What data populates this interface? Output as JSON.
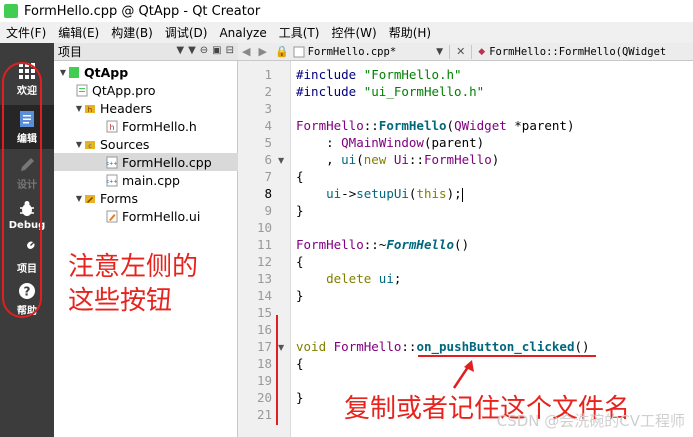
{
  "window": {
    "title": "FormHello.cpp @ QtApp - Qt Creator"
  },
  "menu": [
    "文件(F)",
    "编辑(E)",
    "构建(B)",
    "调试(D)",
    "Analyze",
    "工具(T)",
    "控件(W)",
    "帮助(H)"
  ],
  "modes": [
    {
      "label": "欢迎",
      "icon": "grid-icon"
    },
    {
      "label": "编辑",
      "icon": "document-edit-icon"
    },
    {
      "label": "设计",
      "icon": "pencil-icon"
    },
    {
      "label": "Debug",
      "icon": "bug-icon"
    },
    {
      "label": "项目",
      "icon": "wrench-icon"
    },
    {
      "label": "帮助",
      "icon": "help-icon"
    }
  ],
  "project_panel": {
    "title": "项目",
    "tree": [
      {
        "label": "QtApp",
        "level": 0,
        "kind": "project",
        "expanded": true
      },
      {
        "label": "QtApp.pro",
        "level": 1,
        "kind": "pro"
      },
      {
        "label": "Headers",
        "level": 1,
        "kind": "folder",
        "expanded": true
      },
      {
        "label": "FormHello.h",
        "level": 2,
        "kind": "header"
      },
      {
        "label": "Sources",
        "level": 1,
        "kind": "folder",
        "expanded": true
      },
      {
        "label": "FormHello.cpp",
        "level": 2,
        "kind": "cpp",
        "selected": true
      },
      {
        "label": "main.cpp",
        "level": 2,
        "kind": "cpp"
      },
      {
        "label": "Forms",
        "level": 1,
        "kind": "folder",
        "expanded": true
      },
      {
        "label": "FormHello.ui",
        "level": 2,
        "kind": "ui"
      }
    ]
  },
  "editor": {
    "tab_file": "FormHello.cpp*",
    "breadcrumb": "FormHello::FormHello(QWidget",
    "line_numbers": [
      "1",
      "2",
      "3",
      "4",
      "5",
      "6",
      "7",
      "8",
      "9",
      "10",
      "11",
      "12",
      "13",
      "14",
      "15",
      "16",
      "17",
      "18",
      "19",
      "20",
      "21"
    ],
    "current_line": 8
  },
  "annotations": {
    "left_note_line1": "注意左侧的",
    "left_note_line2": "这些按钮",
    "bottom_note": "复制或者记住这个文件名"
  },
  "watermark": "CSDN @会洗碗的CV工程师",
  "colors": {
    "annotation": "#e8231d",
    "mode_bar": "#3c3c3c",
    "mode_active": "#262626"
  }
}
